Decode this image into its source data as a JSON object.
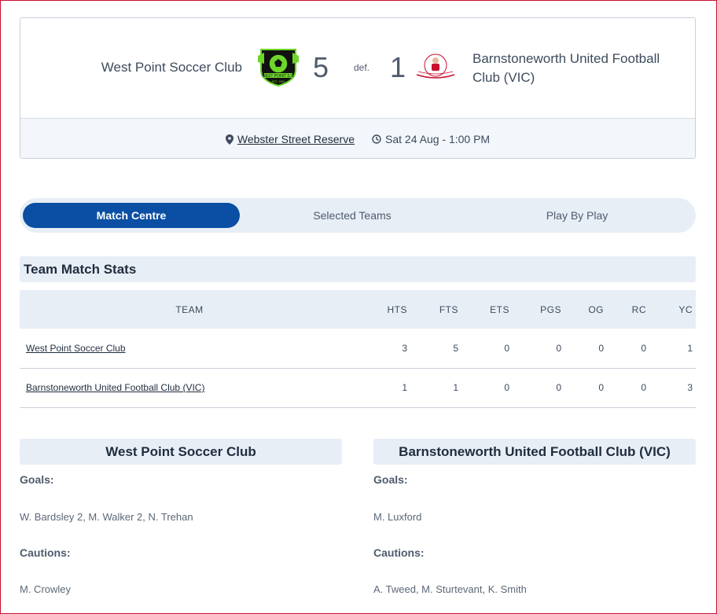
{
  "match": {
    "home_team": "West Point Soccer Club",
    "away_team": "Barnstoneworth United Football Club (VIC)",
    "home_score": "5",
    "away_score": "1",
    "result_word": "def.",
    "venue": "Webster Street Reserve",
    "datetime": "Sat 24 Aug - 1:00 PM",
    "home_logo_text": "WEST POINT S.C.",
    "home_logo_est": "EST. 1963"
  },
  "tabs": [
    {
      "label": "Match Centre",
      "active": true
    },
    {
      "label": "Selected Teams",
      "active": false
    },
    {
      "label": "Play By Play",
      "active": false
    }
  ],
  "stats": {
    "title": "Team Match Stats",
    "columns": [
      "TEAM",
      "HTS",
      "FTS",
      "ETS",
      "PGS",
      "OG",
      "RC",
      "YC"
    ],
    "rows": [
      {
        "team": "West Point Soccer Club",
        "values": [
          "3",
          "5",
          "0",
          "0",
          "0",
          "0",
          "1"
        ]
      },
      {
        "team": "Barnstoneworth United Football Club (VIC)",
        "values": [
          "1",
          "1",
          "0",
          "0",
          "0",
          "0",
          "3"
        ]
      }
    ]
  },
  "summaries": [
    {
      "team": "West Point Soccer Club",
      "goals_label": "Goals:",
      "goals": "W. Bardsley 2, M. Walker 2, N. Trehan",
      "cautions_label": "Cautions:",
      "cautions": "M. Crowley"
    },
    {
      "team": "Barnstoneworth United Football Club (VIC)",
      "goals_label": "Goals:",
      "goals": "M. Luxford",
      "cautions_label": "Cautions:",
      "cautions": "A. Tweed, M. Sturtevant, K. Smith"
    }
  ],
  "colors": {
    "accent": "#0a4fa3",
    "panel": "#e8eef6",
    "home_logo": "#6dd62a"
  },
  "icons": {
    "venue": "map-pin-icon",
    "time": "clock-icon"
  }
}
